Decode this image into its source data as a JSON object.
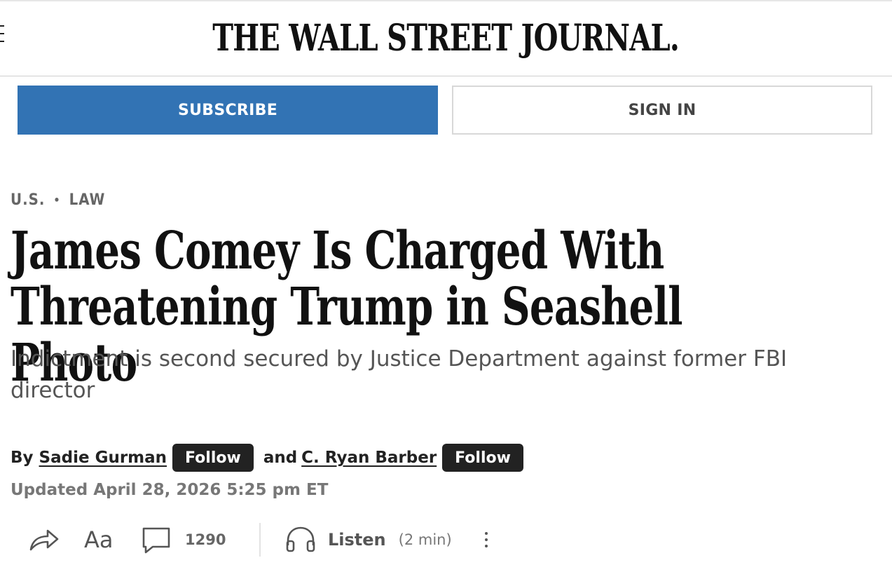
{
  "header": {
    "masthead": "THE WALL STREET JOURNAL."
  },
  "actions": {
    "subscribe_label": "SUBSCRIBE",
    "signin_label": "SIGN IN"
  },
  "breadcrumb": {
    "section": "U.S.",
    "separator": "•",
    "subsection": "LAW"
  },
  "article": {
    "headline": "James Comey Is Charged With Threatening Trump in Seashell Photo",
    "dek": "Indictment is second secured by Justice Department against former FBI director",
    "byline": {
      "prefix": "By",
      "authors": [
        {
          "name": "Sadie Gurman",
          "follow_label": "Follow"
        },
        {
          "name": "C. Ryan Barber",
          "follow_label": "Follow"
        }
      ],
      "conjunction": "and"
    },
    "updated": "Updated April 28, 2026 5:25 pm ET"
  },
  "toolbar": {
    "share_icon": "share-arrow-icon",
    "text_size_label": "Aa",
    "comments_icon": "comment-icon",
    "comment_count": "1290",
    "listen_icon": "headphones-icon",
    "listen_label": "Listen",
    "listen_duration": "(2 min)",
    "more_icon": "more-vertical-icon"
  },
  "colors": {
    "subscribe_bg": "#3273b4",
    "follow_bg": "#222222",
    "text_primary": "#111111",
    "text_secondary": "#555555"
  }
}
